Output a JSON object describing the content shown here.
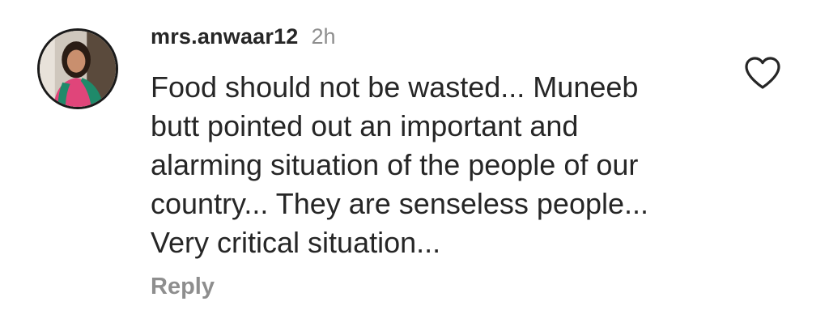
{
  "comment": {
    "username": "mrs.anwaar12",
    "timestamp": "2h",
    "text_lines": [
      "Food should not be wasted... Muneeb",
      "butt pointed out an important and",
      "alarming situation of the people of our",
      "country... They are senseless people...",
      "Very critical situation..."
    ],
    "reply_label": "Reply",
    "like_icon": "heart-outline-icon",
    "avatar_icon": "user-avatar-photo"
  },
  "colors": {
    "primary_text": "#262626",
    "secondary_text": "#8e8e8e",
    "background": "#ffffff"
  }
}
